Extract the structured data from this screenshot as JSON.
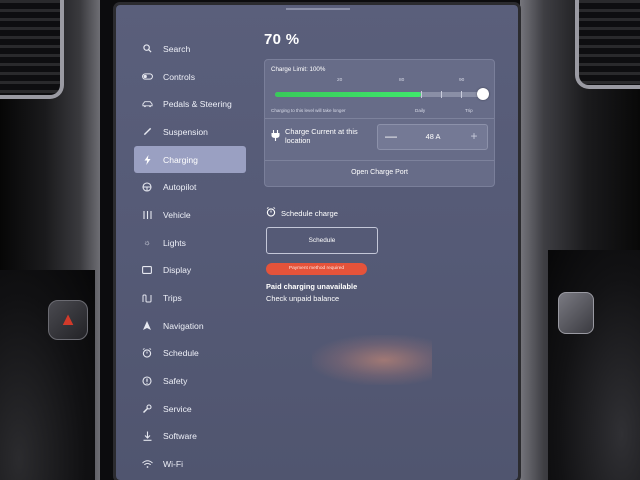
{
  "sidebar": {
    "items": [
      {
        "label": "Search",
        "icon": "search-icon",
        "active": false
      },
      {
        "label": "Controls",
        "icon": "toggle-icon",
        "active": false
      },
      {
        "label": "Pedals & Steering",
        "icon": "car-icon",
        "active": false
      },
      {
        "label": "Suspension",
        "icon": "wrench-icon",
        "active": false
      },
      {
        "label": "Charging",
        "icon": "bolt-icon",
        "active": true
      },
      {
        "label": "Autopilot",
        "icon": "steering-wheel-icon",
        "active": false
      },
      {
        "label": "Vehicle",
        "icon": "vehicle-bars-icon",
        "active": false
      },
      {
        "label": "Lights",
        "icon": "sun-icon",
        "active": false
      },
      {
        "label": "Display",
        "icon": "display-icon",
        "active": false
      },
      {
        "label": "Trips",
        "icon": "route-icon",
        "active": false
      },
      {
        "label": "Navigation",
        "icon": "navigation-arrow-icon",
        "active": false
      },
      {
        "label": "Schedule",
        "icon": "alarm-clock-icon",
        "active": false
      },
      {
        "label": "Safety",
        "icon": "safety-icon",
        "active": false
      },
      {
        "label": "Service",
        "icon": "service-wrench-icon",
        "active": false
      },
      {
        "label": "Software",
        "icon": "download-icon",
        "active": false
      },
      {
        "label": "Wi-Fi",
        "icon": "wifi-icon",
        "active": false
      }
    ]
  },
  "charging": {
    "battery_percent": "70 %",
    "charge_limit_label": "Charge Limit: 100%",
    "charge_limit_value": 100,
    "battery_level_value": 70,
    "ticks": [
      "20",
      "50",
      "80",
      "90"
    ],
    "note": "Charging to this level will take longer",
    "daily_label": "Daily",
    "trip_label": "Trip",
    "current_label": "Charge Current at this location",
    "current_value": "48 A",
    "minus_label": "—",
    "plus_label": "+",
    "open_port_label": "Open Charge Port",
    "schedule_header": "Schedule charge",
    "schedule_button": "Schedule",
    "payment_badge": "Payment method required",
    "paid_unavailable": "Paid charging unavailable",
    "check_balance": "Check unpaid balance"
  },
  "colors": {
    "screen_bg": "#575c78",
    "active_tab": "#9aa0c2",
    "slider_green": "#3fe86b",
    "badge_red": "#e5533a"
  }
}
